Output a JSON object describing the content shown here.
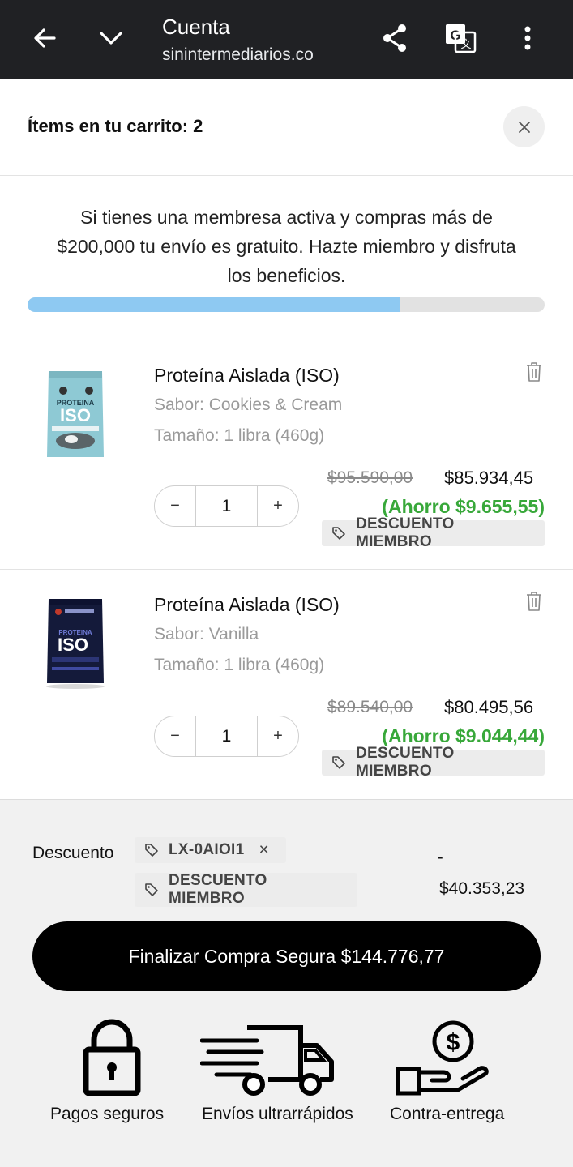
{
  "browser": {
    "title": "Cuenta",
    "url": "sinintermediarios.co",
    "icons": [
      "back-arrow-icon",
      "chevron-down-icon",
      "share-icon",
      "translate-icon",
      "more-vert-icon"
    ]
  },
  "cart": {
    "title": "Ítems en tu carrito: 2",
    "membership_text": "Si tienes una membresa activa y compras más de $200,000 tu envío es gratuito. Hazte miembro y disfruta los beneficios.",
    "progress": 0.72,
    "progress_color": "#8ec9f2",
    "items": [
      {
        "name": "Proteína Aislada (ISO)",
        "flavor": "Sabor: Cookies & Cream",
        "size": "Tamaño: 1 libra (460g)",
        "quantity": "1",
        "minus": "−",
        "plus": "+",
        "old_price": "$95.590,00",
        "new_price": "$85.934,45",
        "savings": "(Ahorro $9.655,55)",
        "badge": "DESCUENTO MIEMBRO",
        "package_color": "#8ec9d4",
        "package_label": "ISO"
      },
      {
        "name": "Proteína Aislada (ISO)",
        "flavor": "Sabor: Vanilla",
        "size": "Tamaño: 1 libra (460g)",
        "quantity": "1",
        "minus": "−",
        "plus": "+",
        "old_price": "$89.540,00",
        "new_price": "$80.495,56",
        "savings": "(Ahorro $9.044,44)",
        "badge": "DESCUENTO MIEMBRO",
        "package_color": "#141a3a",
        "package_label": "ISO"
      }
    ]
  },
  "summary": {
    "discount_label": "Descuento",
    "coupon_code": "LX-0AIOI1",
    "coupon_remove": "×",
    "member_badge": "DESCUENTO MIEMBRO",
    "discount_sign": "-",
    "discount_amount": "$40.353,23",
    "cta": "Finalizar Compra Segura $144.776,77",
    "savings_color": "#38a83a"
  },
  "benefits": [
    {
      "label": "Pagos seguros",
      "icon": "padlock-icon"
    },
    {
      "label": "Envíos ultrarrápidos",
      "icon": "fast-truck-icon"
    },
    {
      "label": "Contra-entrega",
      "icon": "hand-coin-icon"
    }
  ]
}
